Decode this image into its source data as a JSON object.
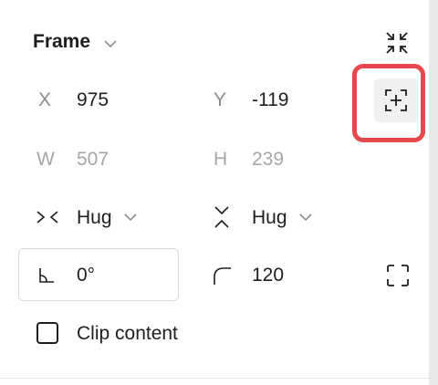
{
  "panel": {
    "title": "Frame",
    "position": {
      "x_label": "X",
      "x_value": "975",
      "y_label": "Y",
      "y_value": "-119"
    },
    "size": {
      "w_label": "W",
      "w_value": "507",
      "h_label": "H",
      "h_value": "239"
    },
    "resizing": {
      "horizontal": "Hug",
      "vertical": "Hug"
    },
    "rotation": "0°",
    "corner_radius": "120",
    "clip_content_label": "Clip content",
    "clip_content_checked": false
  },
  "colors": {
    "highlight": "#e5484d",
    "text": "#1e1e1e",
    "label": "#8c8c8c",
    "dim": "#a6a6a6"
  },
  "icons": [
    "chevron-down-icon",
    "collapse-icon",
    "add-position-icon",
    "hug-horizontal-icon",
    "hug-vertical-icon",
    "rotation-angle-icon",
    "corner-radius-icon",
    "independent-corners-icon",
    "checkbox-icon"
  ]
}
